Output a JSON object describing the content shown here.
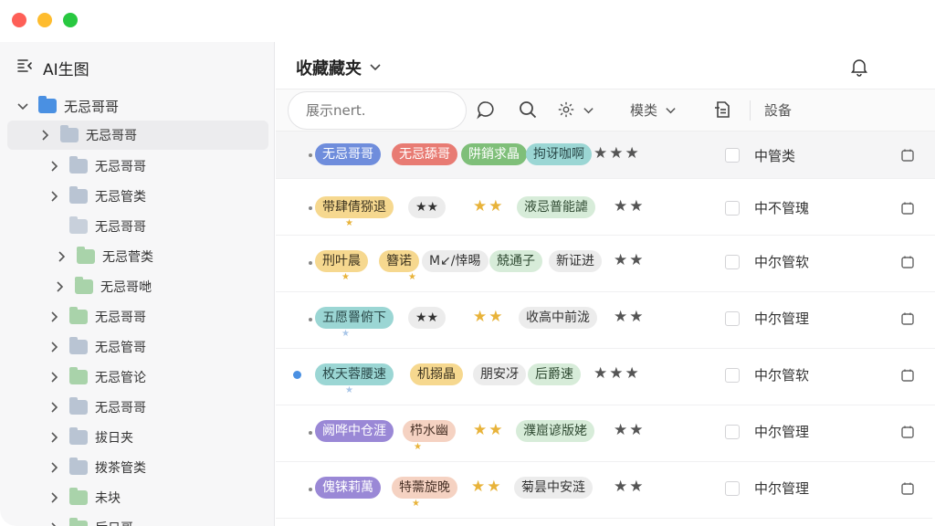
{
  "window": {
    "controls": [
      "close",
      "minimize",
      "zoom"
    ]
  },
  "sidebar": {
    "title": "AI生图",
    "items": [
      {
        "label": "无忌哥哥",
        "folder": "blue",
        "chevron": "down",
        "indent": 0
      },
      {
        "label": "无忌哥哥",
        "folder": "gray",
        "chevron": "right",
        "indent": 1,
        "selected": true
      },
      {
        "label": "无忌哥哥",
        "folder": "gray",
        "chevron": "right",
        "indent": 2
      },
      {
        "label": "无忌管类",
        "folder": "gray",
        "chevron": "right",
        "indent": 2
      },
      {
        "label": "无忌哥哥",
        "folder": "lgray",
        "chevron": "",
        "indent": 2
      },
      {
        "label": "无忌菅类",
        "folder": "green",
        "chevron": "right",
        "indent": 3
      },
      {
        "label": "无忌哥哋",
        "folder": "green",
        "chevron": "right",
        "indent": 3
      },
      {
        "label": "无忌哥哥",
        "folder": "green",
        "chevron": "right",
        "indent": 2
      },
      {
        "label": "无忌管哥",
        "folder": "gray",
        "chevron": "right",
        "indent": 2
      },
      {
        "label": "无忌管论",
        "folder": "green",
        "chevron": "right",
        "indent": 2
      },
      {
        "label": "无忌哥哥",
        "folder": "gray",
        "chevron": "right",
        "indent": 2
      },
      {
        "label": "拔日夹",
        "folder": "gray",
        "chevron": "right",
        "indent": 2
      },
      {
        "label": "拨茶管类",
        "folder": "gray",
        "chevron": "right",
        "indent": 2
      },
      {
        "label": "未块",
        "folder": "green",
        "chevron": "right",
        "indent": 2
      },
      {
        "label": "后日哥",
        "folder": "green",
        "chevron": "right",
        "indent": 2
      }
    ]
  },
  "main": {
    "title": "收藏藏夹",
    "bell_icon": "bell-icon"
  },
  "toolbar": {
    "search_text": "展示nert.",
    "filter_label": "模类",
    "equip_label": "設备",
    "icons": [
      "chat-bubble-icon",
      "search-icon",
      "gear-icon",
      "document-icon"
    ]
  },
  "rows": [
    {
      "tags": [
        {
          "text": "无忌哥哥",
          "color": "blue"
        },
        {
          "text": "无忌舔哥",
          "color": "red"
        },
        {
          "text": "阱銷求晶",
          "color": "green"
        },
        {
          "text": "拘讶咖啊",
          "color": "teal"
        }
      ],
      "stars_dark": "★★★",
      "category": "中管类"
    },
    {
      "tags": [
        {
          "text": "带肆倩猕退",
          "color": "yellow"
        },
        {
          "text": "★★",
          "color": "gray"
        },
        {
          "text": "液忌普能謔",
          "color": "lgreen"
        }
      ],
      "stars_gold": "★★",
      "stars_dark": "★★",
      "category": "中不管瑰"
    },
    {
      "tags": [
        {
          "text": "刑叶晨",
          "color": "yellow"
        },
        {
          "text": "簪诺",
          "color": "yellow"
        },
        {
          "text": "M↙/悻晹",
          "color": "gray"
        },
        {
          "text": "兢通子",
          "color": "lgreen"
        },
        {
          "text": "新证进",
          "color": "gray"
        }
      ],
      "stars_dark": "★★",
      "category": "中尔管软"
    },
    {
      "tags": [
        {
          "text": "五愿罾俯下",
          "color": "teal"
        },
        {
          "text": "★★",
          "color": "gray"
        },
        {
          "text": "收高中前泷",
          "color": "gray"
        }
      ],
      "stars_gold": "★★",
      "stars_dark": "★★",
      "category": "中尔管理"
    },
    {
      "tags": [
        {
          "text": "枚天蓉腰速",
          "color": "teal"
        },
        {
          "text": "机搦晶",
          "color": "yellow"
        },
        {
          "text": "朋安冴",
          "color": "gray"
        },
        {
          "text": "后爵速",
          "color": "lgreen"
        }
      ],
      "stars_dark": "★★★",
      "category": "中尔管软"
    },
    {
      "tags": [
        {
          "text": "阙哗中仓涯",
          "color": "purple"
        },
        {
          "text": "栉水幽",
          "color": "peach"
        },
        {
          "text": "濮崫谚版姥",
          "color": "lgreen"
        }
      ],
      "stars_gold": "★★",
      "stars_dark": "★★",
      "category": "中尔管理"
    },
    {
      "tags": [
        {
          "text": "傀铼莉萬",
          "color": "purple"
        },
        {
          "text": "特薷旋晚",
          "color": "peach"
        },
        {
          "text": "菊昙中安涟",
          "color": "gray"
        }
      ],
      "stars_gold": "★★",
      "stars_dark": "★★",
      "category": "中尔管理"
    }
  ]
}
